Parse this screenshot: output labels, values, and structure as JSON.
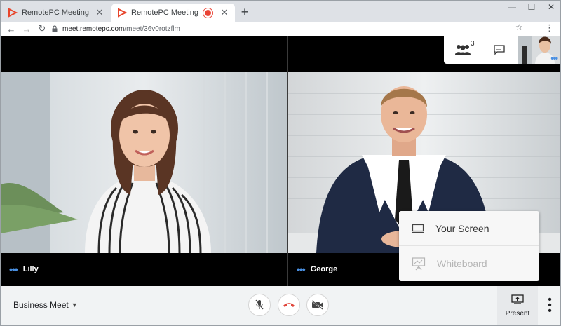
{
  "browser": {
    "tabs": [
      {
        "title": "RemotePC Meeting",
        "active": false
      },
      {
        "title": "RemotePC Meeting",
        "active": true,
        "recording": true
      }
    ],
    "url_host": "meet.remotepc.com",
    "url_path": "/meet/36v0rotzflm",
    "window_controls": [
      "minimize-icon",
      "maximize-icon",
      "close-icon"
    ]
  },
  "meeting": {
    "participants": [
      {
        "name": "Lilly"
      },
      {
        "name": "George"
      }
    ],
    "participant_count": "3",
    "name": "Business Meet",
    "present_label": "Present",
    "present_menu": [
      {
        "label": "Your Screen",
        "enabled": true
      },
      {
        "label": "Whiteboard",
        "enabled": false
      }
    ]
  },
  "colors": {
    "accent": "#4a90e2",
    "hangup": "#e0463c",
    "record": "#ea4335",
    "brand": "#e8452b"
  }
}
